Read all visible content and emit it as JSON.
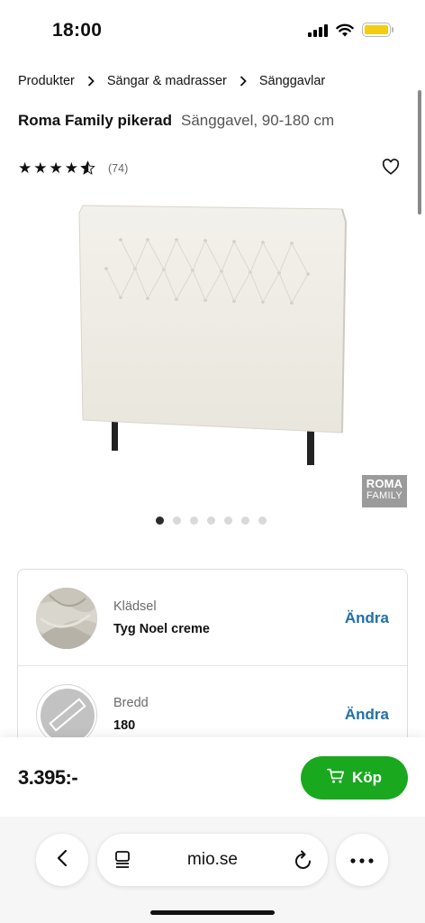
{
  "status_bar": {
    "time": "18:00",
    "battery_color": "#f5cc15"
  },
  "breadcrumb": [
    "Produkter",
    "Sängar & madrasser",
    "Sänggavlar"
  ],
  "product": {
    "name": "Roma Family pikerad",
    "subtitle": "Sänggavel, 90-180 cm",
    "rating": 4.5,
    "rating_max": 5,
    "review_count": "(74)",
    "brand_logo_line1": "ROMA",
    "brand_logo_line2": "FAMILY"
  },
  "gallery": {
    "image_count": 7,
    "active_index": 0
  },
  "options": [
    {
      "label": "Klädsel",
      "value": "Tyg Noel creme",
      "action": "Ändra"
    },
    {
      "label": "Bredd",
      "value": "180",
      "action": "Ändra"
    }
  ],
  "purchase": {
    "price": "3.395:-",
    "buy_label": "Köp",
    "button_color": "#19a81e"
  },
  "browser": {
    "url": "mio.se"
  },
  "icons": [
    "chevron-right-icon",
    "star-icon",
    "heart-icon",
    "cart-icon",
    "back-icon",
    "reader-icon",
    "reload-icon",
    "more-icon"
  ]
}
